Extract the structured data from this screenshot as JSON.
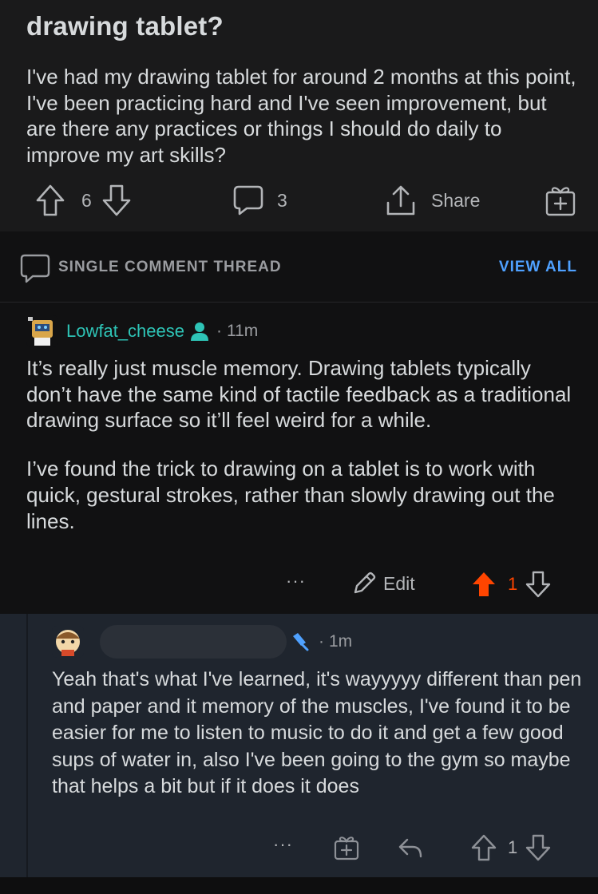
{
  "post": {
    "title": "drawing tablet?",
    "body": "I've had my drawing tablet for around 2 months at this point, I've been practicing hard and I've seen improvement, but are there any practices or things I should do daily to improve my art skills?",
    "vote_count": "6",
    "comment_count": "3",
    "share_label": "Share"
  },
  "thread": {
    "label": "SINGLE COMMENT THREAD",
    "view_all": "VIEW ALL"
  },
  "comment": {
    "username": "Lowfat_cheese",
    "separator": "·",
    "time": "11m",
    "paragraph1": "It’s really just muscle memory. Drawing tablets typically don’t have the same kind of tactile feedback as a traditional drawing surface so it’ll feel weird for a while.",
    "paragraph2": "I’ve found the trick to drawing on a tablet is to work with quick, gestural strokes, rather than slowly drawing out the lines.",
    "more": "···",
    "edit_label": "Edit",
    "vote_count": "1",
    "upvote_color": "#ff4500"
  },
  "reply": {
    "separator": "·",
    "time": "1m",
    "text": "Yeah that's what I've learned, it's wayyyyy different than pen and paper and it memory of the muscles, I've found it to be easier for me to listen to music to do it and get a few good sups of water in, also I've been going to the gym so maybe that helps a bit but if it does it does",
    "more": "···",
    "vote_count": "1"
  },
  "colors": {
    "accent": "#4fa1ff",
    "username": "#2ec4b6",
    "upvote": "#ff4500"
  }
}
